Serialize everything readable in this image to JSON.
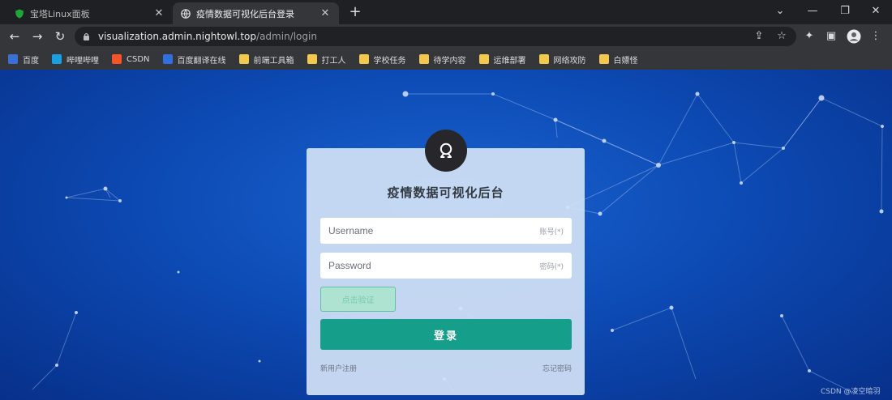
{
  "browser": {
    "tabs": [
      {
        "title": "宝塔Linux面板",
        "active": false,
        "favicon": "shield-icon"
      },
      {
        "title": "疫情数据可视化后台登录",
        "active": true,
        "favicon": "globe-icon"
      }
    ],
    "new_tab": "+",
    "window_controls": {
      "menu": "⌄",
      "minimize": "—",
      "maximize": "❐",
      "close": "✕"
    },
    "url": {
      "host": "visualization.admin.nightowl.top",
      "path": "/admin/login"
    },
    "nav": {
      "back": "←",
      "forward": "→",
      "reload": "↻"
    },
    "bookmarks": [
      {
        "label": "百度",
        "icon": "paw-icon",
        "color": "#3b6fd8"
      },
      {
        "label": "哔哩哔哩",
        "icon": "tv-icon",
        "color": "#1aa0e0"
      },
      {
        "label": "CSDN",
        "icon": "csdn-icon",
        "color": "#f5542a"
      },
      {
        "label": "百度翻译在线",
        "icon": "translate-icon",
        "color": "#2f6fe0"
      },
      {
        "label": "前端工具箱",
        "icon": "folder-icon",
        "color": "#f2c94c"
      },
      {
        "label": "打工人",
        "icon": "folder-icon",
        "color": "#f2c94c"
      },
      {
        "label": "学校任务",
        "icon": "folder-icon",
        "color": "#f2c94c"
      },
      {
        "label": "待学内容",
        "icon": "folder-icon",
        "color": "#f2c94c"
      },
      {
        "label": "运维部署",
        "icon": "folder-icon",
        "color": "#f2c94c"
      },
      {
        "label": "网络攻防",
        "icon": "folder-icon",
        "color": "#f2c94c"
      },
      {
        "label": "白嫖怪",
        "icon": "folder-icon",
        "color": "#f2c94c"
      }
    ]
  },
  "login": {
    "title": "疫情数据可视化后台",
    "username_placeholder": "Username",
    "username_hint": "账号(*)",
    "password_placeholder": "Password",
    "password_hint": "密码(*)",
    "captcha_label": "点击验证",
    "submit_label": "登录",
    "register_link": "新用户注册",
    "forgot_link": "忘记密码"
  },
  "watermark": "CSDN @凌空暗羽",
  "colors": {
    "accent": "#159e8a",
    "captcha_bg": "#aee3d2",
    "page_bg": "#0d4bb5"
  }
}
